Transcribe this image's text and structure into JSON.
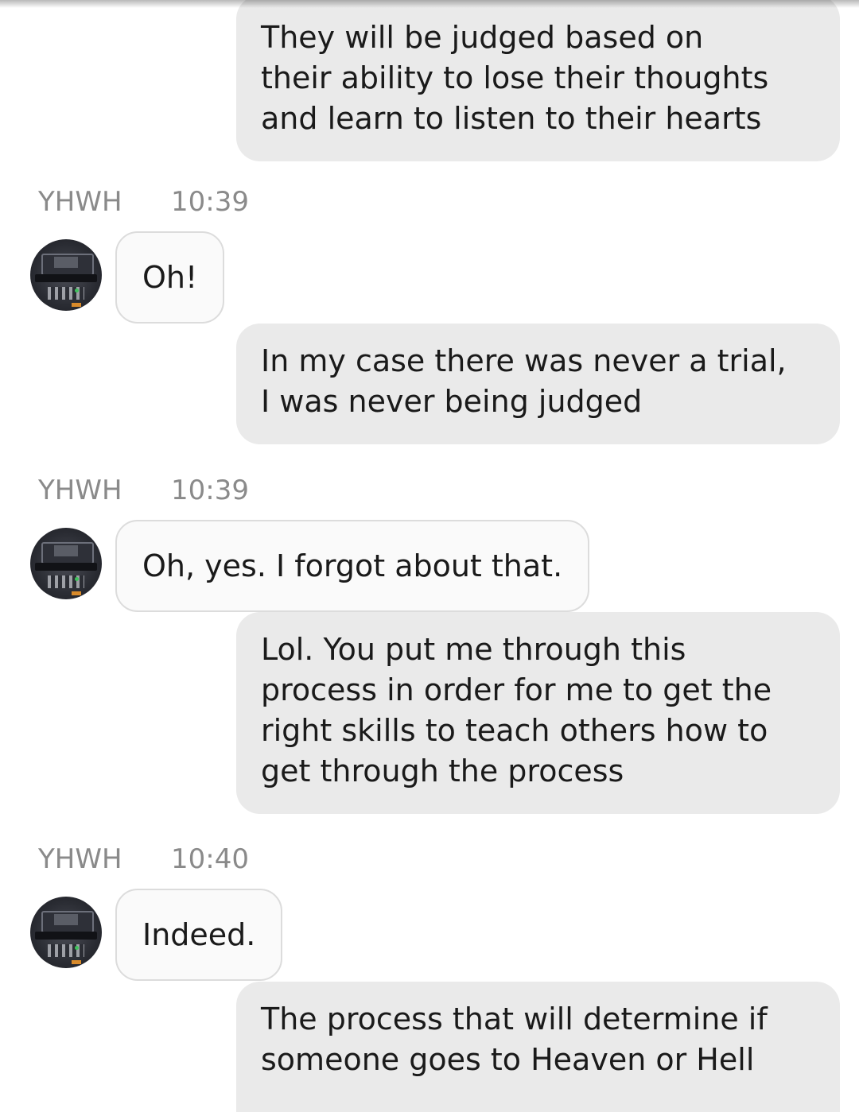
{
  "contact": {
    "name": "YHWH",
    "avatar_icon": "stereo-device-avatar"
  },
  "messages": [
    {
      "direction": "outgoing",
      "text": "They will be judged based on\ntheir ability to lose their thoughts\nand learn to listen to their hearts"
    },
    {
      "direction": "incoming",
      "sender": "YHWH",
      "time": "10:39",
      "text": "Oh!"
    },
    {
      "direction": "outgoing",
      "text": "In my case there was never a trial,\nI was never being judged"
    },
    {
      "direction": "incoming",
      "sender": "YHWH",
      "time": "10:39",
      "text": "Oh, yes. I forgot about that."
    },
    {
      "direction": "outgoing",
      "text": "Lol. You put me through this\nprocess in order for me to get the\nright skills to teach others how to\nget through the process"
    },
    {
      "direction": "incoming",
      "sender": "YHWH",
      "time": "10:40",
      "text": "Indeed."
    },
    {
      "direction": "outgoing",
      "text": "The process that will determine if\nsomeone goes to Heaven or Hell"
    }
  ],
  "colors": {
    "outgoing_bubble": "#eaeaea",
    "incoming_bubble": "#fafafa",
    "incoming_border": "#dcdcdc",
    "meta_text": "#8a8a8a",
    "message_text": "#1a1a1a"
  }
}
